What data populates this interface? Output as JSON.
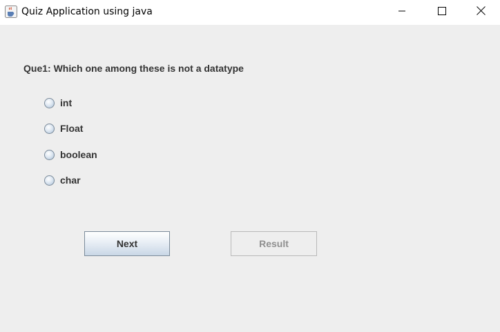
{
  "window": {
    "title": "Quiz Application using java",
    "controls": {
      "minimize_icon": "minimize-icon",
      "maximize_icon": "maximize-icon",
      "close_icon": "close-icon"
    }
  },
  "quiz": {
    "question": "Que1: Which one among these is not a datatype",
    "options": [
      {
        "label": "int",
        "selected": false
      },
      {
        "label": "Float",
        "selected": false
      },
      {
        "label": "boolean",
        "selected": false
      },
      {
        "label": "char",
        "selected": false
      }
    ],
    "buttons": {
      "next_label": "Next",
      "result_label": "Result",
      "result_enabled": false
    }
  },
  "colors": {
    "background": "#eeeeee",
    "titlebar": "#ffffff",
    "text": "#333333",
    "disabled_text": "#8f8f8f"
  }
}
